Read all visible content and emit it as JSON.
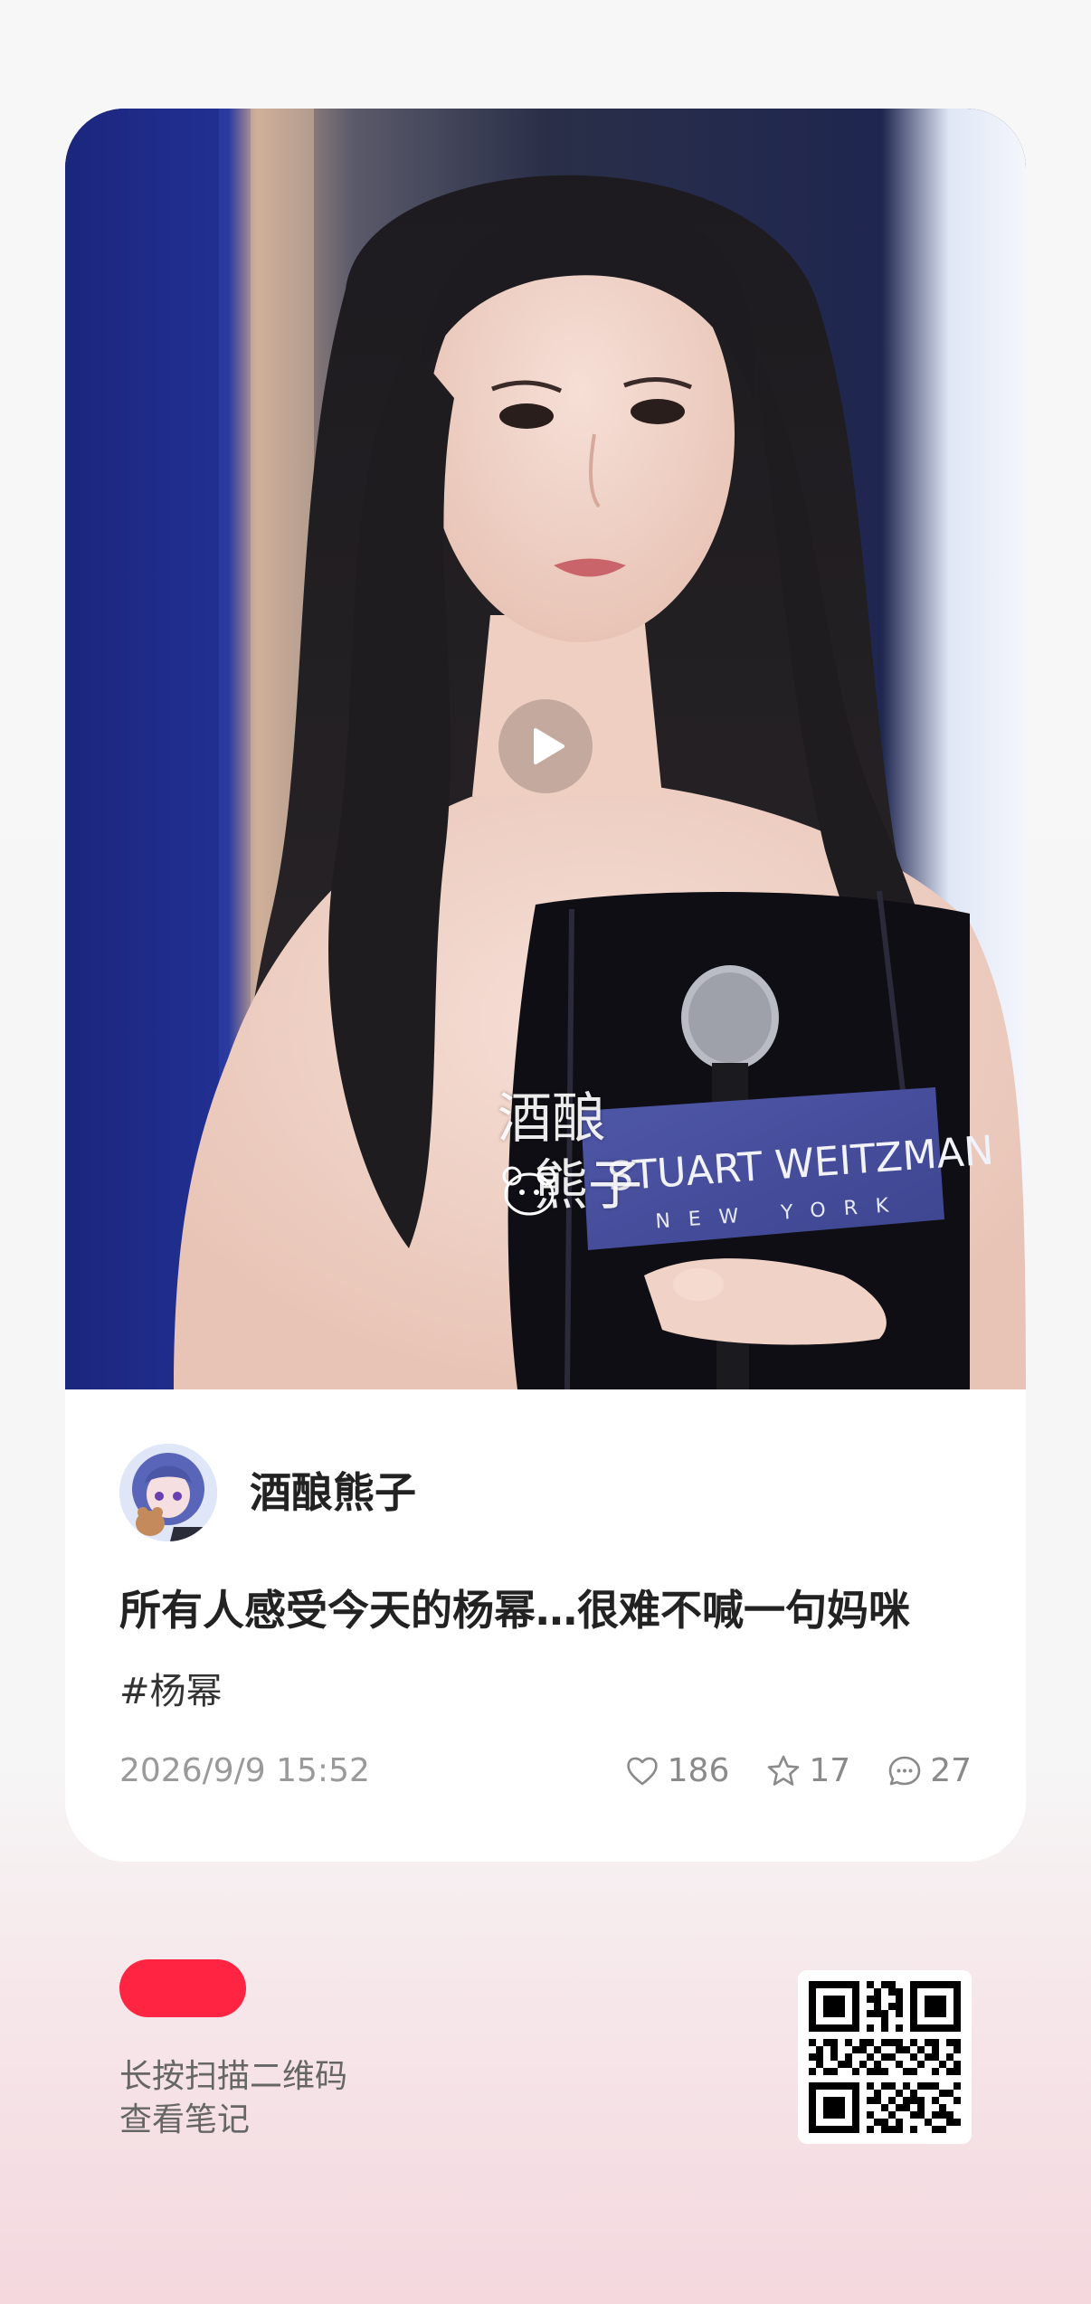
{
  "post": {
    "author": "酒酿熊子",
    "title": "所有人感受今天的杨幂…很难不喊一句妈咪",
    "hashtag": "#杨幂",
    "date": "2026/9/9 15:52",
    "likes": "186",
    "favorites": "17",
    "comments": "27"
  },
  "media": {
    "is_video": true,
    "sign_text_line1": "STUART WEITZMAN",
    "sign_text_line2": "NEW YORK",
    "watermark_line1": "酒酿",
    "watermark_line2": "熊子"
  },
  "footer": {
    "line1": "长按扫描二维码",
    "line2": "查看笔记"
  },
  "colors": {
    "brand": "#ff2442",
    "card": "#ffffff",
    "text_primary": "#222222",
    "text_secondary": "#9a9a9a"
  },
  "icons": {
    "play": "play-icon",
    "like": "heart-icon",
    "favorite": "star-icon",
    "comment": "comment-icon",
    "qr": "qr-code"
  }
}
